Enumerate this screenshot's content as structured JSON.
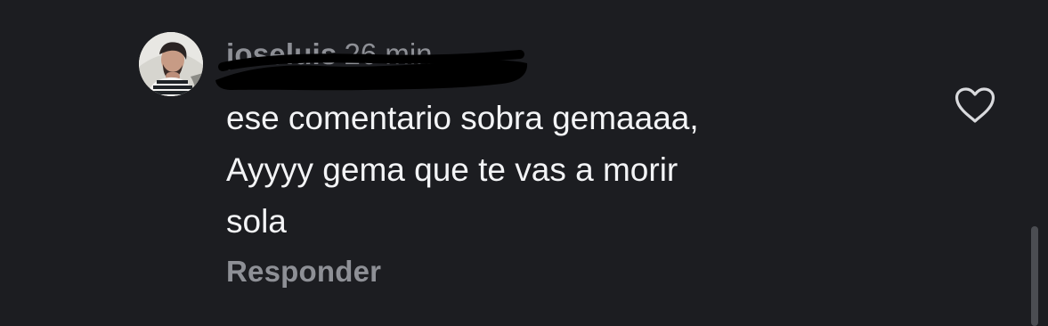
{
  "comment": {
    "username": "joseluis",
    "timestamp": "26 min",
    "text": "ese comentario sobra gemaaaa,\nAyyyy gema que te vas a morir\nsola",
    "reply_label": "Responder"
  },
  "icons": {
    "like": "heart-icon",
    "avatar": "profile-photo"
  },
  "colors": {
    "background": "#1c1d21",
    "primary_text": "#f3f4f6",
    "secondary_text": "#8e9096",
    "icon": "#d9dadd"
  }
}
